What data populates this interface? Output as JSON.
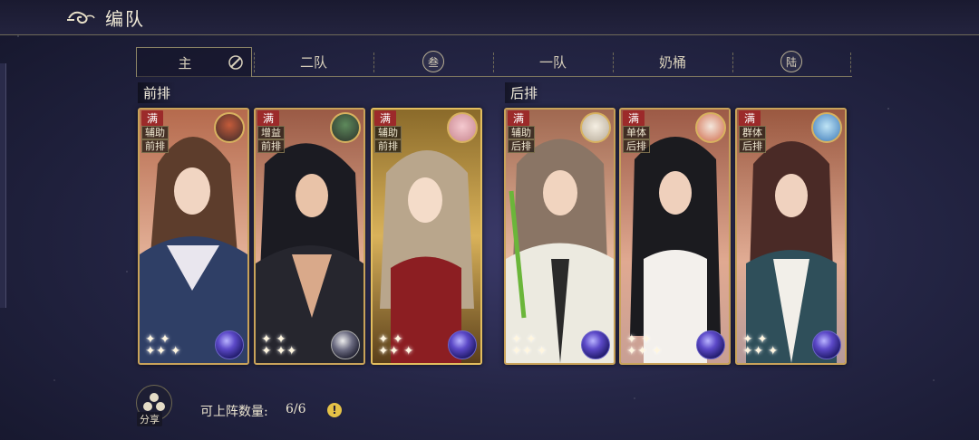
{
  "header": {
    "title": "编队",
    "back_icon": "cloud-swirl-back-icon"
  },
  "tabs": [
    {
      "label": "主",
      "active": true,
      "icon": "edit-pencil-icon"
    },
    {
      "label": "二队",
      "active": false
    },
    {
      "label": "叁",
      "active": false,
      "style": "seal"
    },
    {
      "label": "一队",
      "active": false
    },
    {
      "label": "奶桶",
      "active": false
    },
    {
      "label": "陆",
      "active": false,
      "style": "seal"
    }
  ],
  "rows": {
    "front": "前排",
    "back": "后排"
  },
  "cards": [
    {
      "badge": "满",
      "role": "辅助",
      "position": "前排",
      "pet": "rooster-pet-icon",
      "orb": "violet-orb-icon"
    },
    {
      "badge": "满",
      "role": "增益",
      "position": "前排",
      "pet": "rooster-pet-icon",
      "orb": "planet-orb-icon"
    },
    {
      "badge": "满",
      "role": "辅助",
      "position": "前排",
      "pet": "pig-pet-icon",
      "orb": "violet-orb-icon"
    },
    {
      "badge": "满",
      "role": "辅助",
      "position": "后排",
      "pet": "sheep-pet-icon",
      "orb": "violet-orb-icon"
    },
    {
      "badge": "满",
      "role": "单体",
      "position": "后排",
      "pet": "koi-pet-icon",
      "orb": "violet-orb-icon"
    },
    {
      "badge": "满",
      "role": "群体",
      "position": "后排",
      "pet": "fish-pet-icon",
      "orb": "violet-orb-icon"
    }
  ],
  "footer": {
    "share_label": "分享",
    "count_label": "可上阵数量:",
    "count_value": "6/6",
    "info_icon": "!"
  },
  "colors": {
    "accent_gold": "#c9a35a",
    "badge_red": "#9c2a2a",
    "info_yellow": "#e5c247"
  }
}
